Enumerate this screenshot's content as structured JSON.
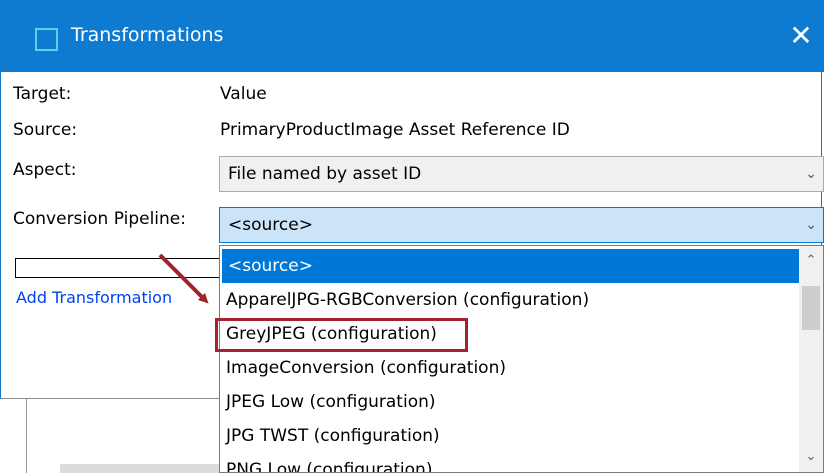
{
  "window": {
    "title": "Transformations",
    "close_glyph": "✕"
  },
  "form": {
    "target_label": "Target:",
    "target_value": "Value",
    "source_label": "Source:",
    "source_value": "PrimaryProductImage Asset Reference ID",
    "aspect_label": "Aspect:",
    "aspect_value": "File named by asset ID",
    "pipeline_label": "Conversion Pipeline:",
    "pipeline_value": "<source>",
    "add_link": "Add Transformation"
  },
  "dropdown": {
    "options": [
      "<source>",
      "ApparelJPG-RGBConversion (configuration)",
      "GreyJPEG (configuration)",
      "ImageConversion (configuration)",
      "JPEG Low (configuration)",
      "JPG TWST (configuration)",
      "PNG Low (configuration)"
    ],
    "selected_index": 0,
    "highlighted_index": 2
  },
  "icons": {
    "caret": "chevron-down-icon",
    "scroll_up": "scroll-up-icon",
    "scroll_down": "scroll-down-icon"
  },
  "colors": {
    "titlebar": "#0e7ad0",
    "selection": "#0078d7",
    "annotation": "#a3232b",
    "link": "#0044ee"
  }
}
